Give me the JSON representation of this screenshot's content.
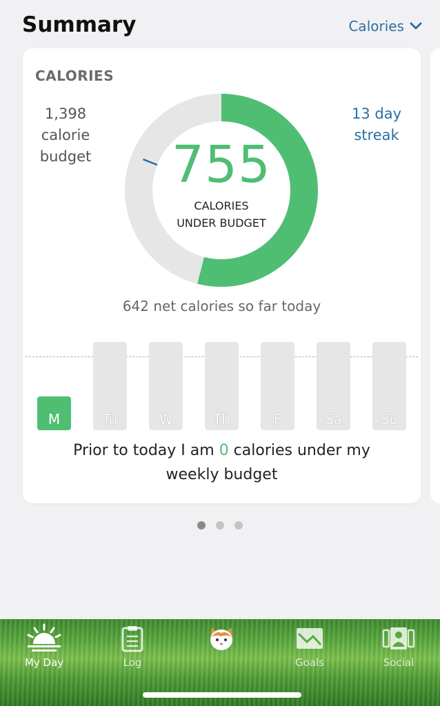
{
  "header": {
    "title": "Summary",
    "metric_selector": "Calories"
  },
  "card": {
    "title": "CALORIES",
    "budget_lines": [
      "1,398",
      "calorie",
      "budget"
    ],
    "streak_lines": [
      "13 day",
      "streak"
    ],
    "under_budget_value": "755",
    "under_budget_label_lines": [
      "CALORIES",
      "UNDER BUDGET"
    ],
    "net_today": "642 net calories so far today",
    "donut": {
      "budget": 1398,
      "net_consumed": 642,
      "remaining": 755,
      "remaining_color": "#4fbe73",
      "track_color": "#e6e6e6",
      "marker_color": "#2a6fa5"
    },
    "week": {
      "days": [
        {
          "label": "M",
          "active": true
        },
        {
          "label": "Tu",
          "active": false
        },
        {
          "label": "W",
          "active": false
        },
        {
          "label": "Th",
          "active": false
        },
        {
          "label": "F",
          "active": false
        },
        {
          "label": "Sa",
          "active": false
        },
        {
          "label": "Su",
          "active": false
        }
      ]
    },
    "prior_text": {
      "before": "Prior to today I am ",
      "value": "0",
      "after": " calories under my weekly budget"
    }
  },
  "pager": {
    "count": 3,
    "active_index": 0
  },
  "tabbar": {
    "tabs": [
      {
        "label": "My Day",
        "icon": "sunrise-icon",
        "active": true
      },
      {
        "label": "Log",
        "icon": "clipboard-icon",
        "active": false
      },
      {
        "label": "",
        "icon": "cat-avatar-icon",
        "active": false
      },
      {
        "label": "Goals",
        "icon": "mountain-chart-icon",
        "active": false
      },
      {
        "label": "Social",
        "icon": "people-icon",
        "active": false
      }
    ]
  },
  "colors": {
    "accent_green": "#4fbe73",
    "link_blue": "#2a6fa5"
  }
}
